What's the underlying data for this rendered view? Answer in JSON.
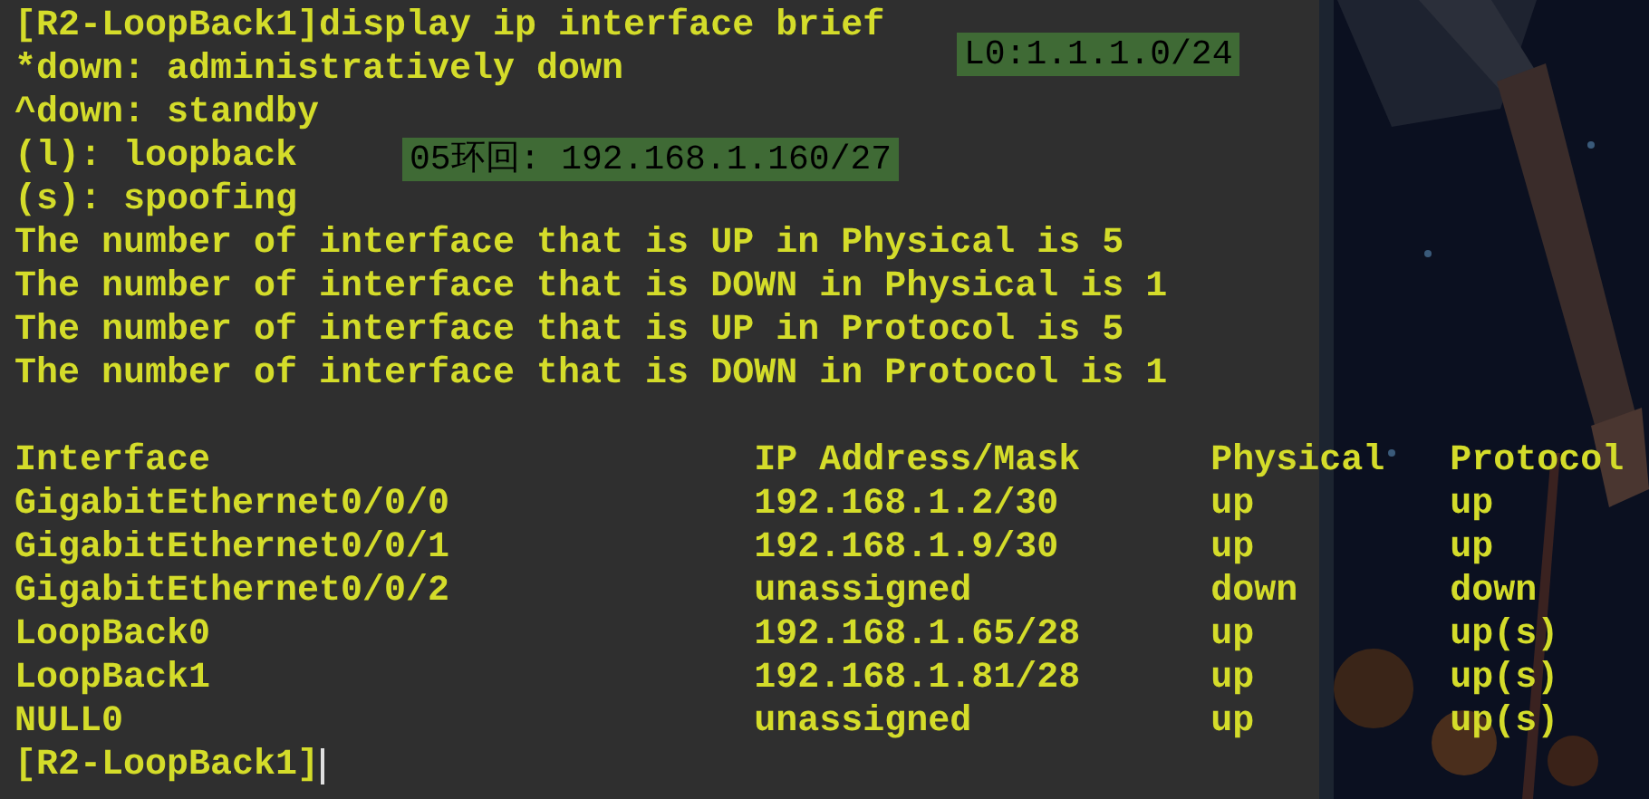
{
  "terminal": {
    "command": "[R2-LoopBack1]display ip interface brief",
    "output_lines": [
      "*down: administratively down",
      "^down: standby",
      "(l): loopback",
      "(s): spoofing",
      "The number of interface that is UP in Physical is 5",
      "The number of interface that is DOWN in Physical is 1",
      "The number of interface that is UP in Protocol is 5",
      "The number of interface that is DOWN in Protocol is 1"
    ],
    "table": {
      "columns": [
        "Interface",
        "IP Address/Mask",
        "Physical",
        "Protocol"
      ],
      "rows": [
        [
          "GigabitEthernet0/0/0",
          "192.168.1.2/30",
          "up",
          "up"
        ],
        [
          "GigabitEthernet0/0/1",
          "192.168.1.9/30",
          "up",
          "up"
        ],
        [
          "GigabitEthernet0/0/2",
          "unassigned",
          "down",
          "down"
        ],
        [
          "LoopBack0",
          "192.168.1.65/28",
          "up",
          "up(s)"
        ],
        [
          "LoopBack1",
          "192.168.1.81/28",
          "up",
          "up(s)"
        ],
        [
          "NULL0",
          "unassigned",
          "up",
          "up(s)"
        ]
      ]
    },
    "prompt": "[R2-LoopBack1]"
  },
  "notes": [
    {
      "kind": "address",
      "text": "L0:1.1.1.0/24"
    },
    {
      "kind": "address-overlay",
      "text": "05环回: 192.168.1.160/27"
    }
  ]
}
